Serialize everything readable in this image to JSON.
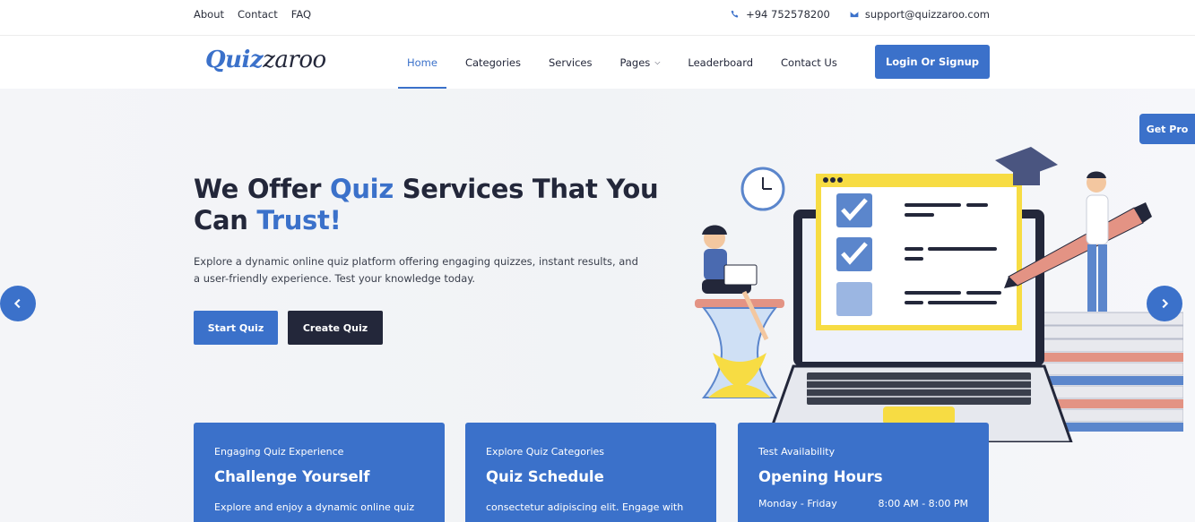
{
  "topbar": {
    "links": [
      "About",
      "Contact",
      "FAQ"
    ],
    "phone": "+94 752578200",
    "email": "support@quizzaroo.com",
    "phone_icon": "phone-icon",
    "email_icon": "envelope-icon"
  },
  "nav": {
    "logo_part1": "Quiz",
    "logo_part2": "zaroo",
    "items": [
      {
        "label": "Home",
        "active": true
      },
      {
        "label": "Categories"
      },
      {
        "label": "Services"
      },
      {
        "label": "Pages",
        "dropdown": true
      },
      {
        "label": "Leaderboard"
      },
      {
        "label": "Contact Us"
      }
    ],
    "login_label": "Login Or Signup"
  },
  "hero": {
    "title_part1": "We Offer ",
    "title_hl1": "Quiz",
    "title_part2": " Services That You Can ",
    "title_hl2": "Trust!",
    "description": "Explore a dynamic online quiz platform offering engaging quizzes, instant results, and a user-friendly experience. Test your knowledge today.",
    "start_label": "Start Quiz",
    "create_label": "Create Quiz",
    "get_pro_label": "Get Pro"
  },
  "cards": [
    {
      "tag": "Engaging Quiz Experience",
      "heading": "Challenge Yourself",
      "body": "Explore and enjoy a dynamic online quiz"
    },
    {
      "tag": "Explore Quiz Categories",
      "heading": "Quiz Schedule",
      "body": "consectetur adipiscing elit. Engage with"
    },
    {
      "tag": "Test Availability",
      "heading": "Opening Hours",
      "days": "Monday - Friday",
      "hours": "8:00 AM - 8:00 PM"
    }
  ],
  "colors": {
    "accent": "#3b71ca",
    "dark": "#23273a"
  }
}
